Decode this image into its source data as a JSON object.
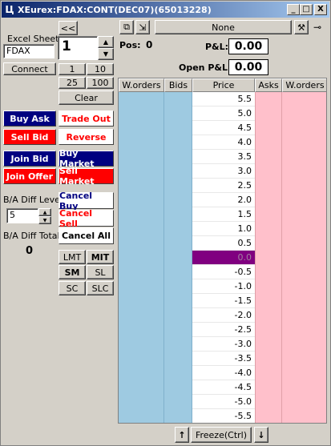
{
  "window": {
    "title": "XEurex:FDAX:CONT(DEC07)(65013228)",
    "minimize": "_",
    "maximize": "□",
    "close": "X"
  },
  "left": {
    "collapse_label": "<<",
    "excel_sheet_label": "Excel Sheet",
    "excel_sheet_value": "FDAX",
    "quantity_value": "1",
    "connect_label": "Connect",
    "qty_1": "1",
    "qty_10": "10",
    "qty_25": "25",
    "qty_100": "100",
    "clear_label": "Clear",
    "buy_ask": "Buy Ask",
    "trade_out": "Trade Out",
    "sell_bid": "Sell Bid",
    "reverse": "Reverse",
    "join_bid": "Join Bid",
    "buy_market": "Buy Market",
    "join_offer": "Join Offer",
    "sell_market": "Sell Market",
    "ba_diff_level_label": "B/A Diff Level",
    "ba_diff_level_value": "5",
    "cancel_buy": "Cancel Buy",
    "cancel_sell": "Cancel Sell",
    "ba_diff_total_label": "B/A Diff Total",
    "ba_diff_total_value": "0",
    "cancel_all": "Cancel All",
    "lmt": "LMT",
    "mit": "MIT",
    "sm": "SM",
    "sl": "SL",
    "sc": "SC",
    "slc": "SLC"
  },
  "top": {
    "account_value": "None",
    "pos_label": "Pos:",
    "pos_value": "0",
    "pl_label": "P&L:",
    "pl_value": "0.00",
    "open_pl_label": "Open P&L:",
    "open_pl_value": "0.00"
  },
  "ladder": {
    "headers": [
      "W.orders",
      "Bids",
      "Price",
      "Asks",
      "W.orders"
    ],
    "current_price": "0.0",
    "prices": [
      "5.5",
      "5.0",
      "4.5",
      "4.0",
      "3.5",
      "3.0",
      "2.5",
      "2.0",
      "1.5",
      "1.0",
      "0.5",
      "0.0",
      "-0.5",
      "-1.0",
      "-1.5",
      "-2.0",
      "-2.5",
      "-3.0",
      "-3.5",
      "-4.0",
      "-4.5",
      "-5.0",
      "-5.5"
    ],
    "colors": {
      "bid_bg": "#9ecae1",
      "ask_bg": "#ffc0cb",
      "current_bg": "#800080"
    }
  },
  "bottom": {
    "freeze_label": "Freeze(Ctrl)",
    "up_arrow": "↑",
    "down_arrow": "↓"
  }
}
